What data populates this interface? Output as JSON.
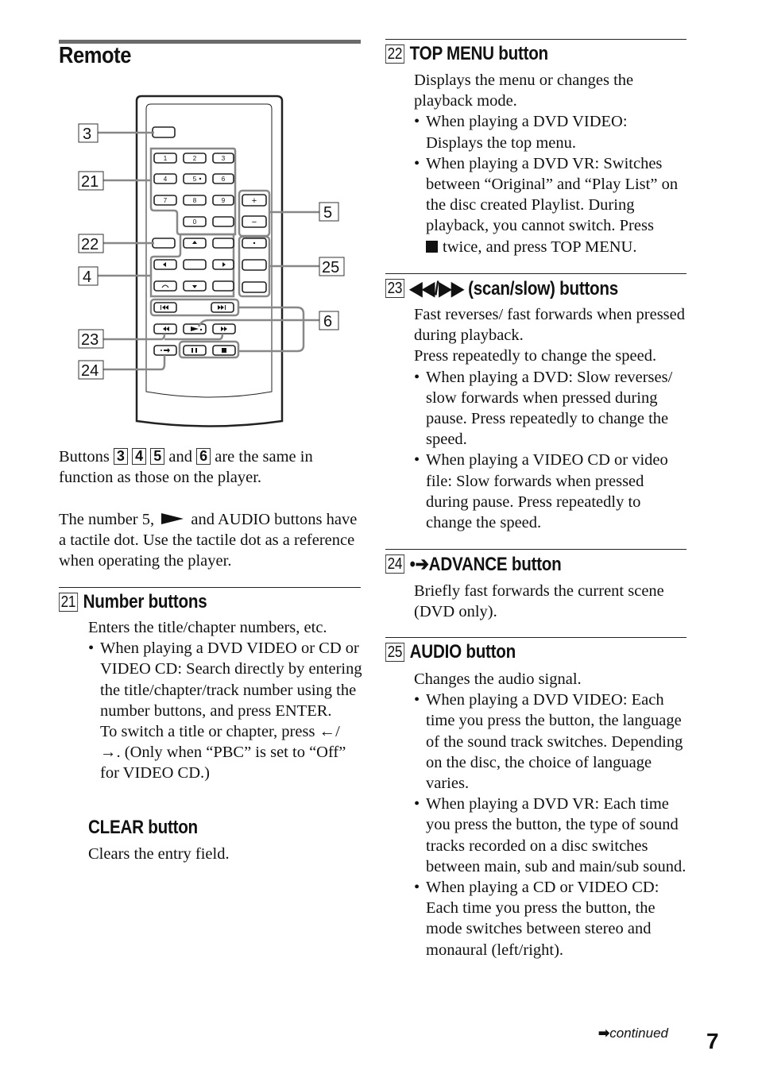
{
  "page": {
    "title": "Remote",
    "page_number": "7",
    "continued": "continued"
  },
  "diagram": {
    "callouts_left": [
      "3",
      "21",
      "22",
      "4",
      "23",
      "24"
    ],
    "callouts_right": [
      "5",
      "25",
      "6"
    ],
    "number_keys": [
      "1",
      "2",
      "3",
      "4",
      "5",
      "6",
      "7",
      "8",
      "9",
      "0"
    ],
    "volume_keys": [
      "+",
      "−"
    ]
  },
  "intro": {
    "p1_prefix": "Buttons",
    "p1_boxes": [
      "3",
      "4",
      "5",
      "6"
    ],
    "p1_and": "and",
    "p1_suffix": "are the same in function as those on the player.",
    "p2_a": "The number 5,",
    "p2_b": "and AUDIO buttons have a tactile dot. Use the tactile dot as a reference when operating the player."
  },
  "sections": {
    "s21": {
      "num": "21",
      "title": "Number buttons",
      "lead": "Enters the title/chapter numbers, etc.",
      "bullet1": "When playing a DVD VIDEO or CD or VIDEO CD: Search directly by entering the title/chapter/track number using the number buttons, and press ENTER.",
      "bullet1_extra_a": "To switch a title or chapter, press",
      "bullet1_extra_b": ". (Only when “PBC” is set to “Off” for VIDEO CD.)",
      "sub_title": "CLEAR button",
      "sub_text": "Clears the entry field."
    },
    "s22": {
      "num": "22",
      "title": "TOP MENU button",
      "lead": "Displays the menu or changes the playback mode.",
      "bullets": [
        "When playing a DVD VIDEO: Displays the top menu.",
        "When playing a DVD VR: Switches between “Original” and “Play List” on the disc created Playlist. During playback, you cannot switch. Press"
      ],
      "bullet2_tail": "twice, and press TOP MENU."
    },
    "s23": {
      "num": "23",
      "title": "(scan/slow) buttons",
      "lead1": "Fast reverses/ fast forwards when pressed during playback.",
      "lead2": "Press repeatedly to change the speed.",
      "bullets": [
        "When playing a DVD: Slow reverses/ slow forwards when pressed during pause. Press repeatedly to change the speed.",
        "When playing a VIDEO CD or video file: Slow forwards when pressed during pause. Press repeatedly to change the speed."
      ]
    },
    "s24": {
      "num": "24",
      "title": "ADVANCE button",
      "lead": "Briefly fast forwards the current scene (DVD only)."
    },
    "s25": {
      "num": "25",
      "title": "AUDIO button",
      "lead": "Changes the audio signal.",
      "bullets": [
        "When playing a DVD VIDEO: Each time you press the button, the language of the sound track switches. Depending on the disc, the choice of language varies.",
        "When playing a DVD VR: Each time you press the button, the type of sound tracks recorded on a disc switches between main, sub and main/sub sound.",
        "When playing a CD or VIDEO CD: Each time you press the button, the mode switches between stereo and monaural (left/right)."
      ]
    }
  }
}
